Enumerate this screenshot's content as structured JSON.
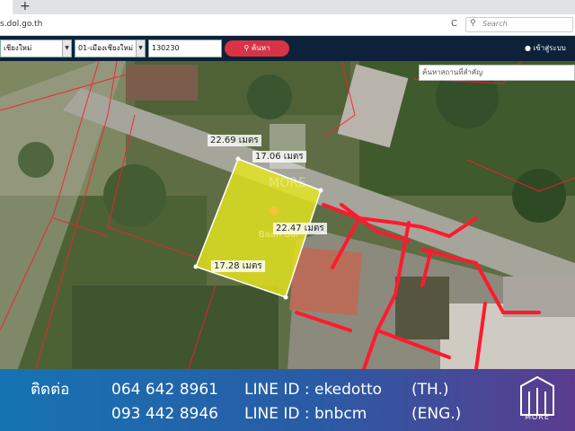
{
  "browser": {
    "new_tab_symbol": "+",
    "url": "s.dol.go.th",
    "reload_symbol": "C",
    "search_placeholder": "Search"
  },
  "toolbar": {
    "province": "เชียงใหม่",
    "district": "01-เมืองเชียงใหม่",
    "parcel_number": "130230",
    "search_label": "ค้นหา",
    "login_label": "เข้าสู่ระบบ"
  },
  "map": {
    "landmark_placeholder": "ค้นหาสถานที่สำคัญ",
    "watermark": "MORE",
    "pin_label": "Baan Bai",
    "dimensions": [
      "22.69 เมตร",
      "17.06 เมตร",
      "22.47 เมตร",
      "17.28 เมตร"
    ],
    "parcel_fill": "#e6e61e",
    "boundary_color": "#ff1a2e"
  },
  "banner": {
    "contact_label": "ติดต่อ",
    "phone_1": "064 642 8961",
    "line_1": "LINE ID : ekedotto",
    "lang_1": "(TH.)",
    "phone_2": "093 442 8946",
    "line_2": "LINE ID : bnbcm",
    "lang_2": "(ENG.)",
    "logo_text": "MORE"
  }
}
